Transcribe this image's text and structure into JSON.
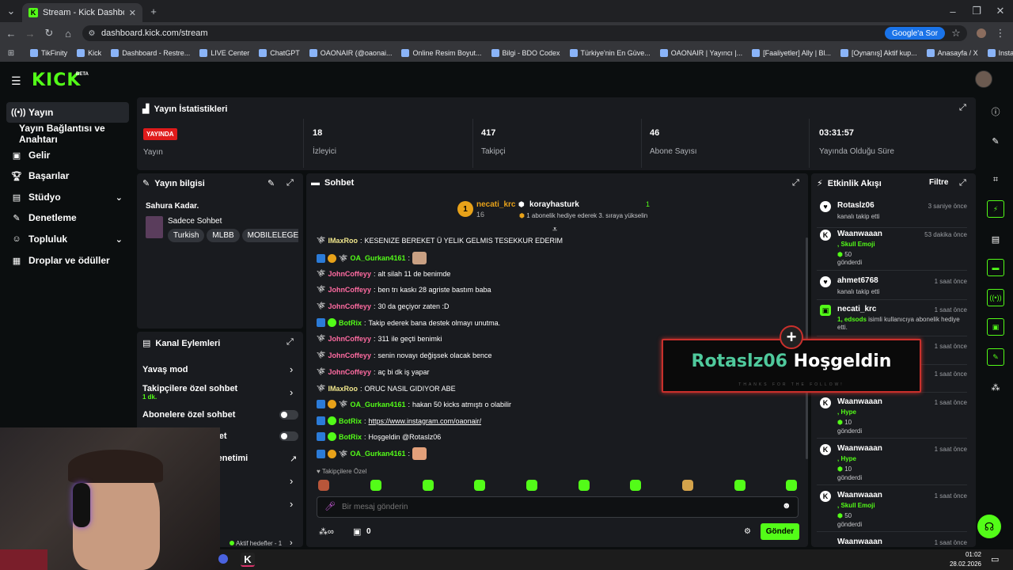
{
  "browser": {
    "tab_title": "Stream - Kick Dashboard",
    "url": "dashboard.kick.com/stream",
    "search_button": "Google'a Sor",
    "bookmarks": [
      "TikFinity",
      "Kick",
      "Dashboard - Restre...",
      "LIVE Center",
      "ChatGPT",
      "OAONAIR (@oaonai...",
      "Online Resim Boyut...",
      "Bilgi - BDO Codex",
      "Türkiye'nin En Güve...",
      "OAONAIR | Yayıncı |...",
      "[Faaliyetler] Ally | Bl...",
      "[Oynanış] Aktif kup...",
      "Anasayfa / X",
      "Instant Background..."
    ]
  },
  "header": {
    "logo": "KICK",
    "badge": "BETA"
  },
  "sidebar": {
    "items": [
      {
        "label": "Yayın",
        "icon": "broadcast-icon"
      },
      {
        "label": "Yayın Bağlantısı ve Anahtarı"
      },
      {
        "label": "Gelir",
        "icon": "wallet-icon"
      },
      {
        "label": "Başarılar",
        "icon": "trophy-icon"
      },
      {
        "label": "Stüdyo",
        "icon": "studio-icon"
      },
      {
        "label": "Denetleme",
        "icon": "wrench-icon"
      },
      {
        "label": "Topluluk",
        "icon": "people-icon"
      },
      {
        "label": "Droplar ve ödüller",
        "icon": "gift-icon"
      }
    ]
  },
  "stats": {
    "title": "Yayın İstatistikleri",
    "live_badge": "YAYINDA",
    "status_label": "Yayın",
    "viewers": "18",
    "viewers_label": "İzleyici",
    "followers": "417",
    "followers_label": "Takipçi",
    "subs": "46",
    "subs_label": "Abone Sayısı",
    "uptime": "03:31:57",
    "uptime_label": "Yayında Olduğu Süre"
  },
  "stream_info": {
    "title": "Yayın bilgisi",
    "stream_title": "Sahura Kadar.",
    "category": "Sadece Sohbet",
    "tags": [
      "Turkish",
      "MLBB",
      "MOBILELEGEN"
    ]
  },
  "channel_actions": {
    "title": "Kanal Eylemleri",
    "slow_mode": "Yavaş mod",
    "followers_only": "Takipçilere özel sohbet",
    "followers_only_value": "1 dk.",
    "subs_only": "Abonelere özel sohbet",
    "partial4": "bet",
    "partial5": "t Denetimi",
    "goals": "Aktif hedefler - 1"
  },
  "chat": {
    "title": "Sohbet",
    "pinned_gifter": "necati_krc",
    "pinned_gifter_count": "16",
    "pinned_user": "korayhasturk",
    "pinned_user_count": "1",
    "pinned_text": "1 abonelik hediye ederek 3. sıraya yükselin",
    "messages": [
      {
        "user": "IMaxRoo",
        "text": "KESENIZE BEREKET Ü YELIK GELMIS TESEKKUR EDERIM"
      },
      {
        "user": "OA_Gurkan4161",
        "text": ""
      },
      {
        "user": "JohnCoffeyy",
        "text": "alt silah 11 de benimde"
      },
      {
        "user": "JohnCoffeyy",
        "text": "ben trı kaskı 28 agriste bastım baba"
      },
      {
        "user": "JohnCoffeyy",
        "text": "30 da geçiyor zaten :D"
      },
      {
        "user": "BotRix",
        "text": "Takip ederek bana destek olmayı unutma."
      },
      {
        "user": "JohnCoffeyy",
        "text": "311 ile geçti benimki"
      },
      {
        "user": "JohnCoffeyy",
        "text": "senin novayı değişsek olacak bence"
      },
      {
        "user": "JohnCoffeyy",
        "text": "aç bi dk iş yapar"
      },
      {
        "user": "IMaxRoo",
        "text": "ORUC NASIL GIDIYOR ABE"
      },
      {
        "user": "OA_Gurkan4161",
        "text": "hakan 50 kicks atmıştı o olabilir"
      },
      {
        "user": "BotRix",
        "text": "https://www.instagram.com/oaonair/"
      },
      {
        "user": "BotRix",
        "text": "Hoşgeldin @Rotaslz06"
      },
      {
        "user": "OA_Gurkan4161",
        "text": ""
      }
    ],
    "emote_bar_label": "Takipçilere Özel",
    "input_placeholder": "Bir mesaj gönderin",
    "points": "0",
    "send": "Gönder"
  },
  "events": {
    "title": "Etkinlik Akışı",
    "filter": "Filtre",
    "items": [
      {
        "user": "Rotaslz06",
        "time": "3 saniye önce",
        "line1": "kanalı takip etti"
      },
      {
        "user": "Waanwaaan",
        "time": "53 dakika önce",
        "line1": ", Skull Emoji",
        "line2": "50",
        "line3": "gönderdi"
      },
      {
        "user": "ahmet6768",
        "time": "1 saat önce",
        "line1": "kanalı takip etti"
      },
      {
        "user": "necati_krc",
        "time": "1 saat önce",
        "line1": "1, edsods",
        "line2": "isimli kullanıcıya abonelik hediye etti."
      },
      {
        "user": "",
        "time": "1 saat önce"
      },
      {
        "user": "",
        "time": "1 saat önce"
      },
      {
        "user": "Waanwaaan",
        "time": "1 saat önce",
        "line1": ", Hype",
        "line2": "10",
        "line3": "gönderdi"
      },
      {
        "user": "Waanwaaan",
        "time": "1 saat önce",
        "line1": ", Hype",
        "line2": "10",
        "line3": "gönderdi"
      },
      {
        "user": "Waanwaaan",
        "time": "1 saat önce",
        "line1": ", Skull Emoji",
        "line2": "50",
        "line3": "gönderdi"
      },
      {
        "user": "Waanwaaan",
        "time": "1 saat önce"
      }
    ]
  },
  "overlay": {
    "name": "Rotaslz06",
    "greeting": "Hoşgeldin",
    "sub": "THANKS FOR THE FOLLOW!"
  },
  "taskbar": {
    "time": "01:02",
    "date": "28.02.2026"
  },
  "colors": {
    "accent": "#53fc18",
    "bg": "#0b0e0f",
    "panel": "#191b1f",
    "live": "#e01b1b"
  }
}
